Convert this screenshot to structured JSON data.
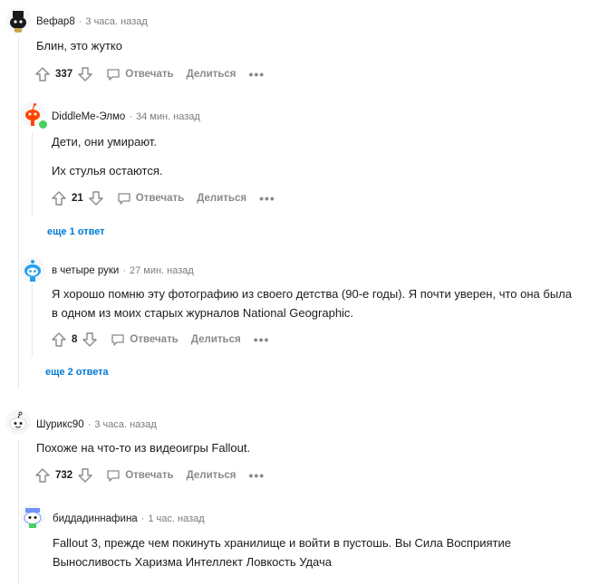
{
  "comments": [
    {
      "author": "Вефар8",
      "time": "3 часа. назад",
      "lines": [
        "Блин, это жутко"
      ],
      "score": "337"
    },
    {
      "author": "DiddleMe-Элмо",
      "time": "34 мин. назад",
      "lines": [
        "Дети, они умирают.",
        "Их стулья остаются."
      ],
      "score": "21"
    },
    {
      "author": "в четыре руки",
      "time": "27 мин. назад",
      "lines": [
        "Я хорошо помню эту фотографию из своего детства (90-е годы). Я почти уверен, что она была",
        "в одном из моих старых журналов National Geographic."
      ],
      "score": "8"
    },
    {
      "author": "Шурикс90",
      "time": "3 часа. назад",
      "lines": [
        "Похоже на что-то из видеоигры Fallout."
      ],
      "score": "732"
    },
    {
      "author": "биддадиннафина",
      "time": "1 час. назад",
      "lines": [
        "Fallout 3, прежде чем покинуть хранилище и войти в пустошь. Вы Сила Восприятие",
        "Выносливость Харизма Интеллект Ловкость Удача"
      ]
    }
  ],
  "labels": {
    "reply": "Отвечать",
    "share": "Делиться",
    "more": "•••"
  },
  "more_replies": [
    "еще 1 ответ",
    "еще 2 ответа"
  ],
  "colors": {
    "link": "#0079d3",
    "online": "#46d160",
    "snoo_orange": "#ff4500"
  }
}
